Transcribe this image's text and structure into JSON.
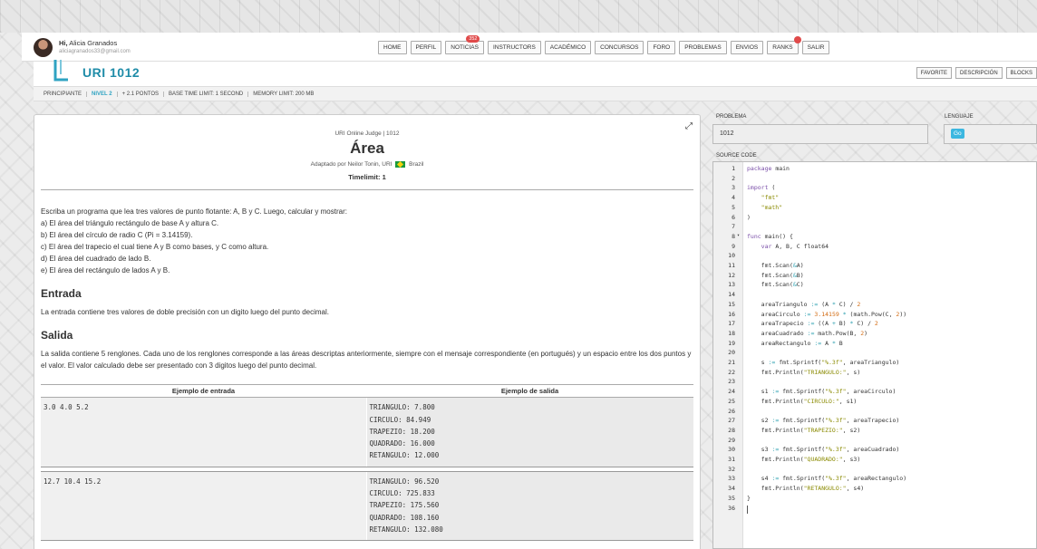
{
  "user": {
    "greeting": "Hi,",
    "name": "Alicia Granados",
    "email": "aliciagranados33@gmail.com"
  },
  "nav": [
    {
      "label": "HOME"
    },
    {
      "label": "PERFIL"
    },
    {
      "label": "NOTICIAS",
      "badge": "352"
    },
    {
      "label": "INSTRUCTORS"
    },
    {
      "label": "ACADÉMICO"
    },
    {
      "label": "CONCURSOS"
    },
    {
      "label": "FORO"
    },
    {
      "label": "PROBLEMAS"
    },
    {
      "label": "ENVIOS"
    },
    {
      "label": "RANKS",
      "dot": true
    },
    {
      "label": "SALIR"
    }
  ],
  "problem_header": {
    "title": "URI 1012",
    "buttons": [
      "FAVORITE",
      "DESCRIPCIÓN",
      "BLOCKS"
    ],
    "info": [
      "PRINCIPIANTE",
      "NIVEL 2",
      "+ 2.1 PONTOS",
      "BASE TIME LIMIT: 1 SECOND",
      "MEMORY LIMIT: 200 MB"
    ]
  },
  "problem": {
    "judge": "URI Online Judge | 1012",
    "title": "Área",
    "adapted_prefix": "Adaptado por Neilor Tonin, URI",
    "country": "Brazil",
    "timelimit": "Timelimit: 1",
    "statement": [
      "Escriba un programa que lea tres valores de punto flotante: A, B y C. Luego, calcular y mostrar:",
      "a) El área del triángulo rectángulo de base A y altura C.",
      "b) El área del círculo de radio C (Pi = 3.14159).",
      "c) El área del trapecio el cual tiene A y B como bases, y C como altura.",
      "d) El área del cuadrado de lado B.",
      "e) El área del rectángulo de lados A y B."
    ],
    "input_title": "Entrada",
    "input_text": "La entrada contiene tres valores de doble precisión con un digito luego del punto decimal.",
    "output_title": "Salida",
    "output_text": "La salida contiene 5 renglones. Cada uno de los renglones corresponde a las áreas descriptas anteriormente, siempre con el mensaje correspondiente (en portugués) y un espacio entre los dos puntos y el valor. El valor calculado debe ser presentado con 3 digitos luego del punto decimal.",
    "examples_header": {
      "input": "Ejemplo de entrada",
      "output": "Ejemplo de salida"
    },
    "examples": [
      {
        "input": "3.0 4.0 5.2",
        "output": [
          "TRIANGULO: 7.800",
          "CIRCULO: 84.949",
          "TRAPEZIO: 18.200",
          "QUADRADO: 16.000",
          "RETANGULO: 12.000"
        ]
      },
      {
        "input": "12.7 10.4 15.2",
        "output": [
          "TRIANGULO: 96.520",
          "CIRCULO: 725.833",
          "TRAPEZIO: 175.560",
          "QUADRADO: 108.160",
          "RETANGULO: 132.080"
        ]
      }
    ]
  },
  "editor": {
    "problem_label": "PROBLEMA",
    "problem_value": "1012",
    "language_label": "LENGUAJE",
    "language_value": "Go",
    "source_label": "SOURCE CODE",
    "code": [
      "package main",
      "",
      "import (",
      "    \"fmt\"",
      "    \"math\"",
      ")",
      "",
      "func main() {",
      "    var A, B, C float64",
      "",
      "    fmt.Scan(&A)",
      "    fmt.Scan(&B)",
      "    fmt.Scan(&C)",
      "",
      "    areaTriangulo := (A * C) / 2",
      "    areaCirculo := 3.14159 * (math.Pow(C, 2))",
      "    areaTrapecio := ((A + B) * C) / 2",
      "    areaCuadrado := math.Pow(B, 2)",
      "    areaRectangulo := A * B",
      "",
      "    s := fmt.Sprintf(\"%.3f\", areaTriangulo)",
      "    fmt.Println(\"TRIANGULO:\", s)",
      "",
      "    s1 := fmt.Sprintf(\"%.3f\", areaCirculo)",
      "    fmt.Println(\"CIRCULO:\", s1)",
      "",
      "    s2 := fmt.Sprintf(\"%.3f\", areaTrapecio)",
      "    fmt.Println(\"TRAPEZIO:\", s2)",
      "",
      "    s3 := fmt.Sprintf(\"%.3f\", areaCuadrado)",
      "    fmt.Println(\"QUADRADO:\", s3)",
      "",
      "    s4 := fmt.Sprintf(\"%.3f\", areaRectangulo)",
      "    fmt.Println(\"RETANGULO:\", s4)",
      "}",
      ""
    ]
  }
}
